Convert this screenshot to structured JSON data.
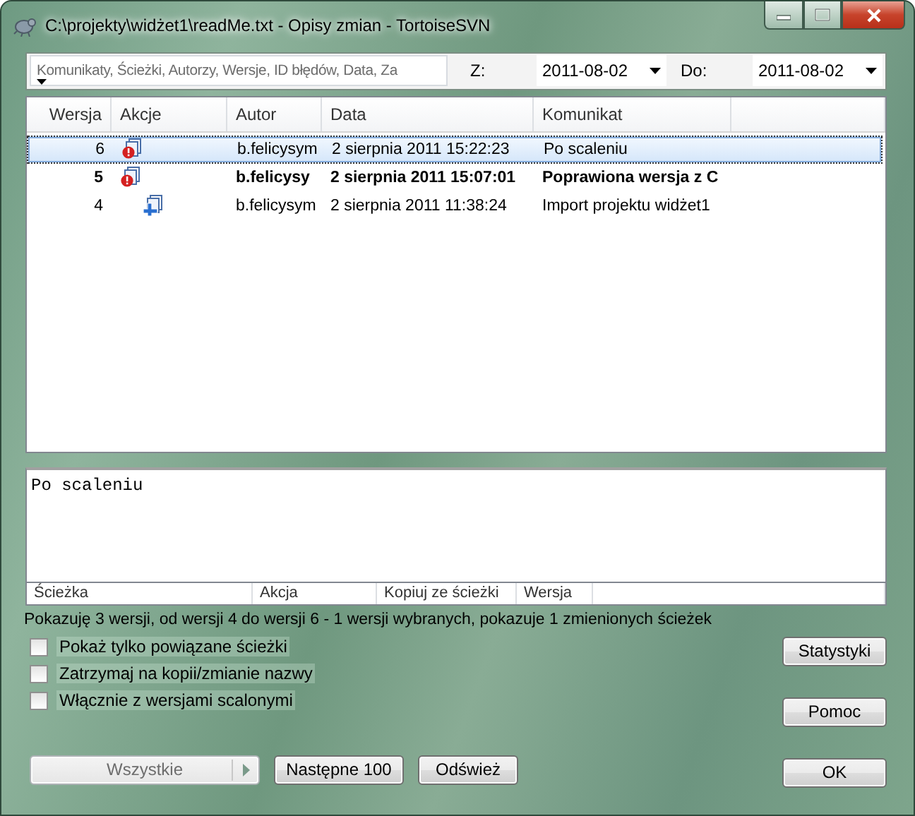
{
  "window": {
    "title": "C:\\projekty\\widżet1\\readMe.txt - Opisy zmian - TortoiseSVN"
  },
  "filter": {
    "placeholder": "Komunikaty, Ścieżki, Autorzy, Wersje, ID błędów, Data, Za",
    "from_label": "Z:",
    "from_value": "2011-08-02",
    "to_label": "Do:",
    "to_value": "2011-08-02"
  },
  "log": {
    "columns": [
      "Wersja",
      "Akcje",
      "Autor",
      "Data",
      "Komunikat"
    ],
    "rows": [
      {
        "revision": "6",
        "kind": "modified",
        "author": "b.felicysym",
        "date": "2 sierpnia 2011 15:22:23",
        "message": "Po scaleniu",
        "selected": true,
        "bold": false
      },
      {
        "revision": "5",
        "kind": "modified",
        "author": "b.felicysy",
        "date": "2 sierpnia 2011 15:07:01",
        "message": "Poprawiona wersja z C",
        "selected": false,
        "bold": true
      },
      {
        "revision": "4",
        "kind": "added",
        "author": "b.felicysym",
        "date": "2 sierpnia 2011 11:38:24",
        "message": "Import projektu widżet1",
        "selected": false,
        "bold": false
      }
    ]
  },
  "message_pane": {
    "text": "Po scaleniu"
  },
  "paths": {
    "columns": [
      "Ścieżka",
      "Akcja",
      "Kopiuj ze ścieżki",
      "Wersja"
    ]
  },
  "status_bar": "Pokazuję 3 wersji, od wersji 4 do wersji 6 - 1 wersji wybranych, pokazuje 1 zmienionych ścieżek",
  "options": [
    {
      "label": "Pokaż tylko powiązane ścieżki",
      "checked": false
    },
    {
      "label": "Zatrzymaj na kopii/zmianie nazwy",
      "checked": false
    },
    {
      "label": "Włącznie z wersjami scalonymi",
      "checked": false
    }
  ],
  "side_buttons": [
    {
      "label": "Statystyki"
    },
    {
      "label": "Pomoc"
    }
  ],
  "bottom_buttons": [
    {
      "label": "Wszystkie",
      "kind": "split",
      "disabled": true
    },
    {
      "label": "Następne 100",
      "kind": "plain",
      "disabled": false
    },
    {
      "label": "Odśwież",
      "kind": "plain",
      "disabled": false
    }
  ],
  "ok_button": {
    "label": "OK"
  }
}
